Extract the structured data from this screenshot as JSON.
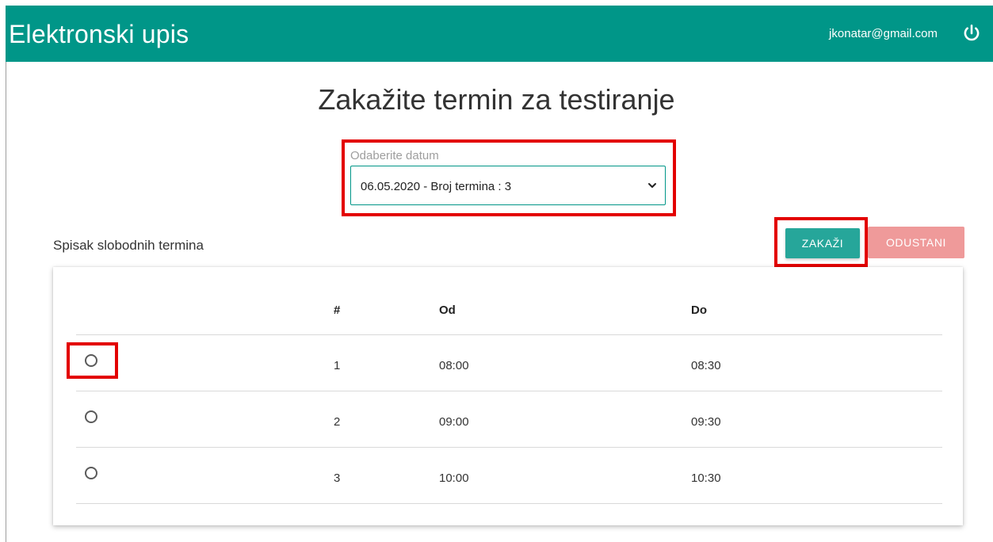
{
  "app": {
    "title": "Elektronski upis",
    "user_email": "jkonatar@gmail.com",
    "logout_icon": "power-icon",
    "brand_color": "#009688"
  },
  "page": {
    "heading": "Zakažite termin za testiranje"
  },
  "date_picker": {
    "label": "Odaberite datum",
    "selected": "06.05.2020 - Broj termina : 3"
  },
  "list": {
    "heading": "Spisak slobodnih termina"
  },
  "actions": {
    "schedule_label": "ZAKAŽI",
    "cancel_label": "ODUSTANI"
  },
  "table": {
    "columns": [
      "",
      "#",
      "Od",
      "Do"
    ],
    "rows": [
      {
        "num": "1",
        "from": "08:00",
        "to": "08:30",
        "selected": false
      },
      {
        "num": "2",
        "from": "09:00",
        "to": "09:30",
        "selected": false
      },
      {
        "num": "3",
        "from": "10:00",
        "to": "10:30",
        "selected": false
      }
    ]
  },
  "annotation_color": "#e30000"
}
